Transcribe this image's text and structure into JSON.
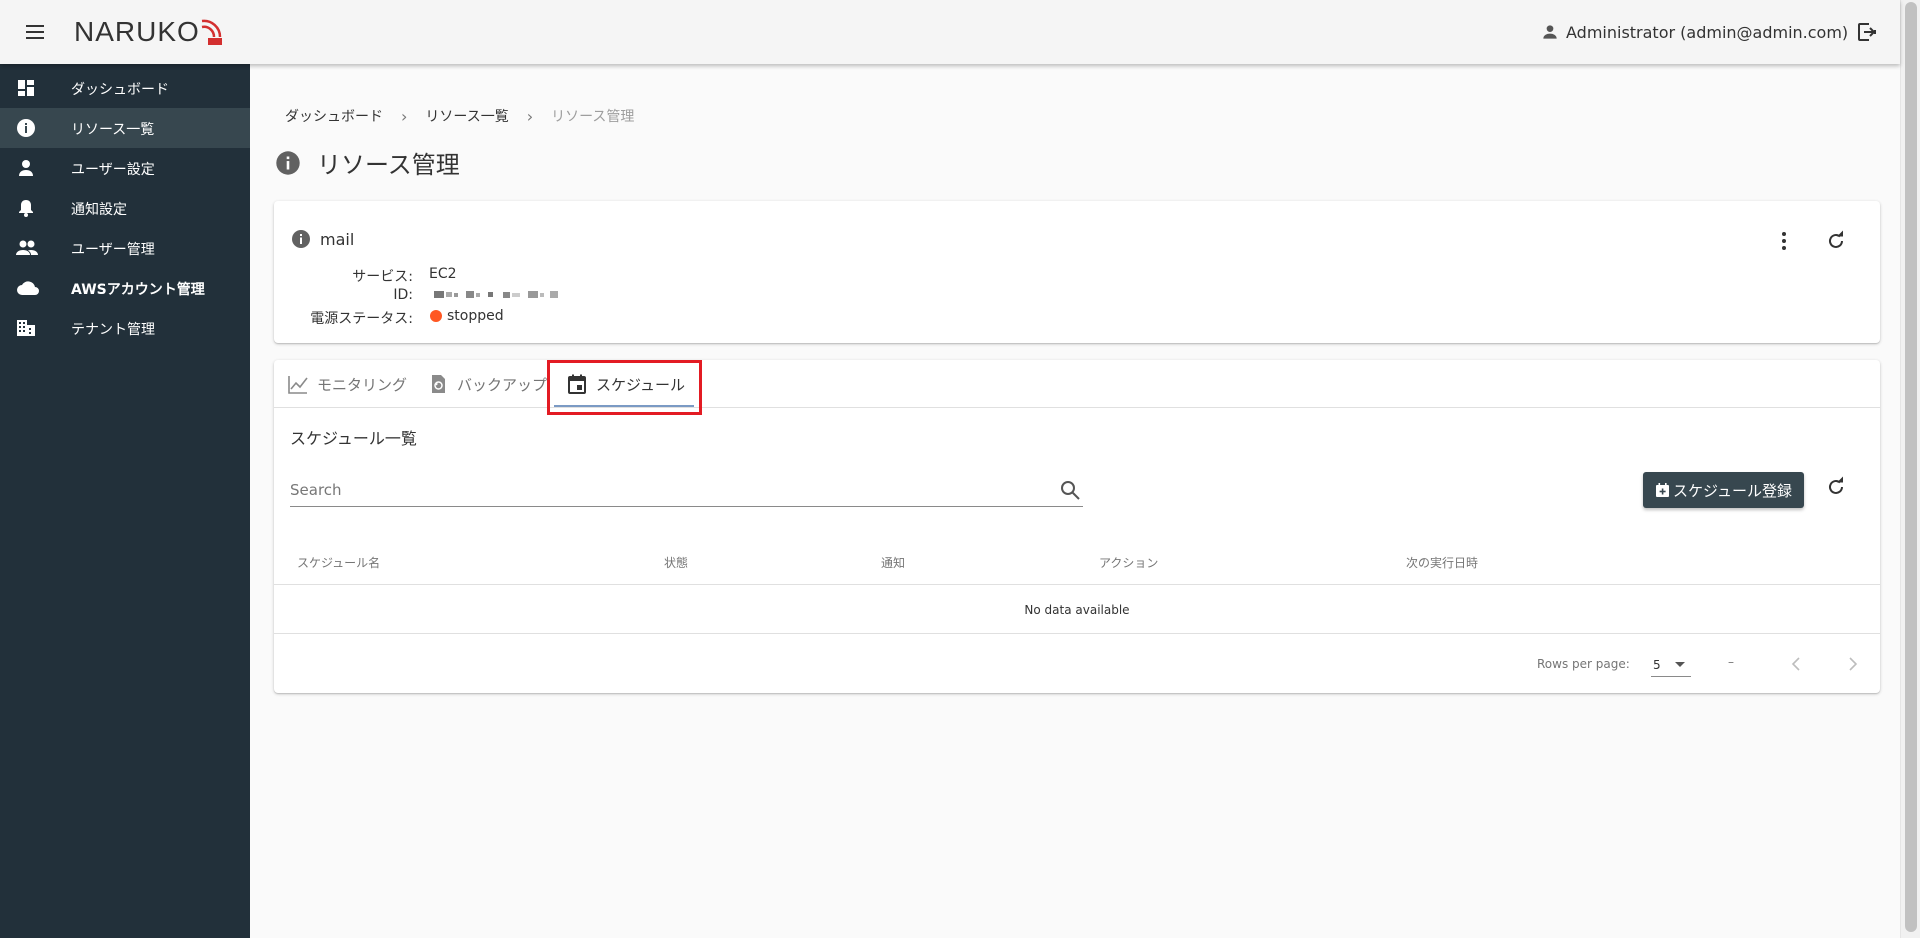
{
  "header": {
    "logo_text": "NARUKO",
    "user_label": "Administrator (admin@admin.com)"
  },
  "sidebar": {
    "items": [
      {
        "label": "ダッシュボード",
        "icon": "dashboard-icon",
        "active": false
      },
      {
        "label": "リソース一覧",
        "icon": "info-icon",
        "active": true
      },
      {
        "label": "ユーザー設定",
        "icon": "person-icon",
        "active": false
      },
      {
        "label": "通知設定",
        "icon": "bell-icon",
        "active": false
      },
      {
        "label": "ユーザー管理",
        "icon": "people-icon",
        "active": false
      },
      {
        "label": "AWSアカウント管理",
        "icon": "cloud-icon",
        "active": false
      },
      {
        "label": "テナント管理",
        "icon": "building-icon",
        "active": false
      }
    ]
  },
  "breadcrumb": {
    "items": [
      "ダッシュボード",
      "リソース一覧",
      "リソース管理"
    ],
    "separator": "›"
  },
  "page": {
    "title": "リソース管理"
  },
  "resource": {
    "name": "mail",
    "service_label": "サービス:",
    "service_value": "EC2",
    "id_label": "ID:",
    "power_label": "電源ステータス:",
    "power_status": "stopped",
    "status_color": "#ff5722"
  },
  "tabs": [
    {
      "label": "モニタリング",
      "icon": "chart-line-icon",
      "active": false
    },
    {
      "label": "バックアップ",
      "icon": "backup-restore-icon",
      "active": false
    },
    {
      "label": "スケジュール",
      "icon": "calendar-icon",
      "active": true
    }
  ],
  "schedule": {
    "section_title": "スケジュール一覧",
    "search_placeholder": "Search",
    "register_button": "スケジュール登録",
    "columns": [
      "スケジュール名",
      "状態",
      "通知",
      "アクション",
      "次の実行日時"
    ],
    "empty_text": "No data available",
    "rows_per_page_label": "Rows per page:",
    "rows_per_page_value": "5",
    "page_range": "–"
  },
  "colors": {
    "sidebar_bg": "#22303a",
    "sidebar_active": "#37474f",
    "primary_button": "#37474f",
    "highlight": "#e31b23"
  }
}
